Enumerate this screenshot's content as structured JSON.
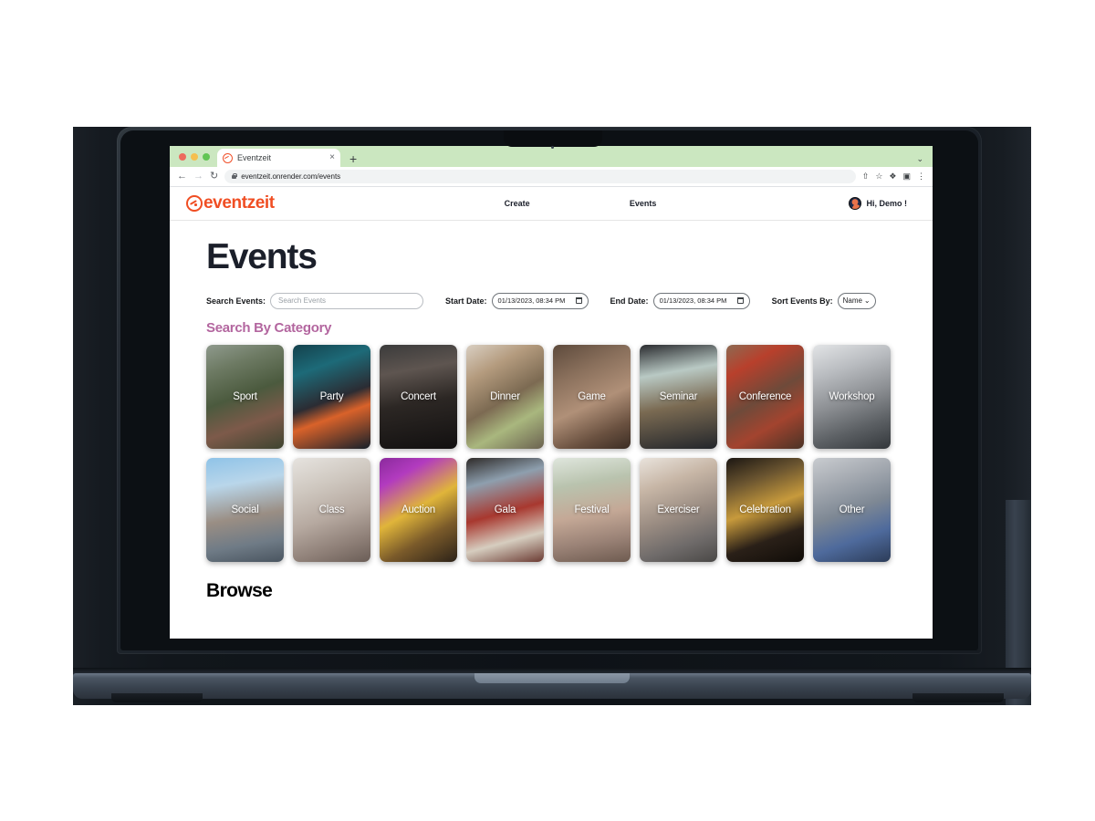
{
  "browser": {
    "tab_title": "Eventzeit",
    "tab_close_glyph": "×",
    "new_tab_glyph": "+",
    "tabstrip_chevron_glyph": "⌄",
    "back_glyph": "←",
    "forward_glyph": "→",
    "reload_glyph": "↻",
    "url": "eventzeit.onrender.com/events",
    "toolbar_icons": [
      "share-icon",
      "bookmark-star-icon",
      "extensions-puzzle-icon",
      "split-screen-icon",
      "overflow-menu-icon"
    ],
    "share_glyph": "⇧",
    "star_glyph": "☆",
    "puzzle_glyph": "❖",
    "split_glyph": "▣",
    "menu_glyph": "⋮",
    "tabstrip_color": "#cbe7c0"
  },
  "site": {
    "logo_text": "eventzeit",
    "logo_color": "#f04e23",
    "nav": [
      {
        "label": "Create"
      },
      {
        "label": "Events"
      }
    ],
    "user_greeting": "Hi, Demo !",
    "page_title": "Events",
    "filters": {
      "search_label": "Search Events:",
      "search_placeholder": "Search Events",
      "search_value": "",
      "start_date_label": "Start Date:",
      "start_date_value": "01/13/2023, 08:34 PM",
      "end_date_label": "End Date:",
      "end_date_value": "01/13/2023, 08:34 PM",
      "sort_label": "Sort Events By:",
      "sort_value": "Name",
      "sort_chevron": "⌄"
    },
    "category_section_title": "Search By Category",
    "category_title_color": "#b3669f",
    "categories": [
      {
        "label": "Sport",
        "bg": "linear-gradient(160deg,#8f9a8d 0%,#6d7a63 22%,#4b5a3e 48%,#7d5a4a 72%,#3e4430 100%)"
      },
      {
        "label": "Party",
        "bg": "linear-gradient(160deg,#14414c 0%,#1d6a78 24%,#2b2c33 52%,#d9622a 66%,#16202a 100%)"
      },
      {
        "label": "Concert",
        "bg": "linear-gradient(170deg,#3b3b3b 0%,#5e5550 26%,#2c2724 55%,#121010 100%)"
      },
      {
        "label": "Dinner",
        "bg": "linear-gradient(150deg,#d9cfc2 0%,#b49b7e 25%,#7c6a52 52%,#a9b77e 72%,#6b6250 100%)"
      },
      {
        "label": "Game",
        "bg": "linear-gradient(155deg,#5d4a3c 0%,#8a705c 28%,#b09078 55%,#6a5140 80%,#3b2d24 100%)"
      },
      {
        "label": "Seminar",
        "bg": "linear-gradient(170deg,#2a2b2f 0%,#b9c9c4 28%,#7a6a52 58%,#23262b 100%)"
      },
      {
        "label": "Conference",
        "bg": "linear-gradient(150deg,#8d6a52 0%,#b8402c 22%,#6e4a3a 50%,#a3442f 72%,#4a3326 100%)"
      },
      {
        "label": "Workshop",
        "bg": "linear-gradient(160deg,#e2e4e6 0%,#b9bcc0 26%,#8c8f93 52%,#5c6064 76%,#33373b 100%)"
      },
      {
        "label": "Social",
        "bg": "linear-gradient(170deg,#8fc3e8 0%,#b9d6ea 26%,#9a8e84 56%,#6f7b86 80%,#4a5560 100%)"
      },
      {
        "label": "Class",
        "bg": "linear-gradient(160deg,#e6e3df 0%,#cfc8c0 28%,#b6a9a0 55%,#8e7f77 80%,#6a5d56 100%)"
      },
      {
        "label": "Auction",
        "bg": "linear-gradient(150deg,#8a2a9c 0%,#b23bbf 20%,#e0b53a 48%,#7a5a2a 72%,#2c2218 100%)"
      },
      {
        "label": "Gala",
        "bg": "linear-gradient(165deg,#2e2a28 0%,#8e9fae 24%,#a8382f 52%,#d6cdbf 76%,#6b3a32 100%)"
      },
      {
        "label": "Festival",
        "bg": "linear-gradient(170deg,#dfe6dd 0%,#b9c3ae 26%,#c4a896 54%,#9a8276 78%,#6e5b50 100%)"
      },
      {
        "label": "Exerciser",
        "bg": "linear-gradient(160deg,#e9e3dc 0%,#c7b6a6 26%,#9a8c82 54%,#6f6b6a 78%,#4a4846 100%)"
      },
      {
        "label": "Celebration",
        "bg": "linear-gradient(160deg,#1b1612 0%,#6b5530 24%,#c79a3c 48%,#2a2018 74%,#100c08 100%)"
      },
      {
        "label": "Other",
        "bg": "linear-gradient(160deg,#c9ccd0 0%,#a6abb2 24%,#7e8894 50%,#4e6a9c 74%,#2c3c58 100%)"
      }
    ],
    "browse_title": "Browse"
  }
}
